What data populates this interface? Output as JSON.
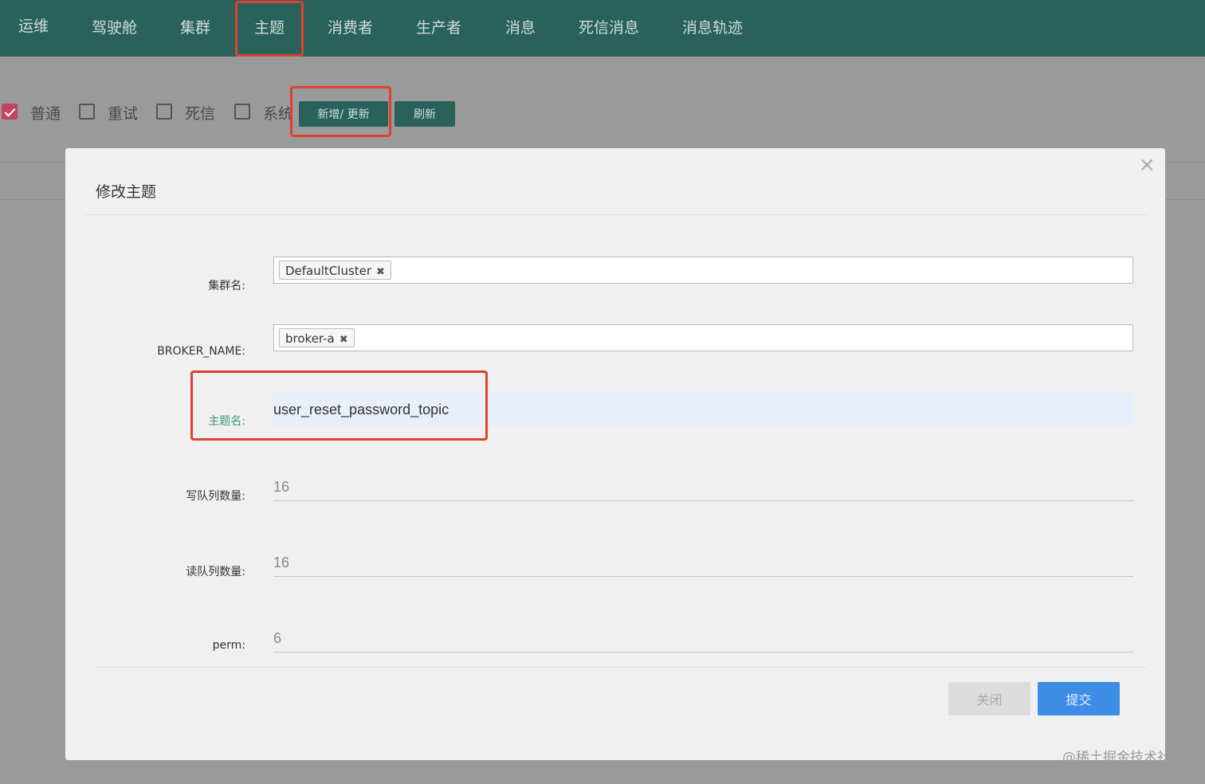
{
  "nav": {
    "items": [
      {
        "label": "运维"
      },
      {
        "label": "驾驶舱"
      },
      {
        "label": "集群"
      },
      {
        "label": "主题"
      },
      {
        "label": "消费者"
      },
      {
        "label": "生产者"
      },
      {
        "label": "消息"
      },
      {
        "label": "死信消息"
      },
      {
        "label": "消息轨迹"
      }
    ],
    "active": "主题"
  },
  "filters": {
    "checkboxes": [
      {
        "label": "普通",
        "checked": true
      },
      {
        "label": "重试",
        "checked": false
      },
      {
        "label": "死信",
        "checked": false
      },
      {
        "label": "系统",
        "checked": false
      }
    ],
    "add_update_label": "新增/ 更新",
    "refresh_label": "刷新"
  },
  "modal": {
    "title": "修改主题",
    "close_icon": "×",
    "fields": {
      "cluster": {
        "label": "集群名:",
        "tag": "DefaultCluster"
      },
      "broker": {
        "label": "BROKER_NAME:",
        "tag": "broker-a"
      },
      "topic": {
        "label": "主题名:",
        "value": "user_reset_password_topic"
      },
      "write_queues": {
        "label": "写队列数量:",
        "value": "16"
      },
      "read_queues": {
        "label": "读队列数量:",
        "value": "16"
      },
      "perm": {
        "label": "perm:",
        "value": "6"
      }
    },
    "tag_remove_icon": "✖",
    "buttons": {
      "close": "关闭",
      "submit": "提交"
    }
  },
  "colors": {
    "nav_bg": "#28625a",
    "checkbox_checked": "#c24463",
    "highlight_border": "#e0412f",
    "submit_bg": "#3d8ce6",
    "topic_label": "#3a9a6e"
  },
  "watermark": "@稀土掘金技术社区"
}
